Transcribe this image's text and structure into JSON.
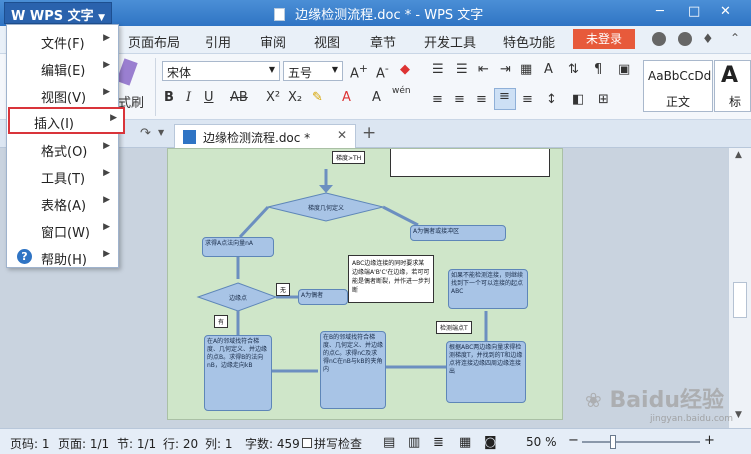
{
  "window": {
    "app_button": "WPS 文字",
    "title": "边缘检测流程.doc * - WPS 文字",
    "controls": [
      "─",
      "□",
      "✕"
    ]
  },
  "menubar": {
    "tabs": [
      "页面布局",
      "引用",
      "审阅",
      "视图",
      "章节",
      "开发工具",
      "特色功能"
    ],
    "login": "未登录"
  },
  "ribbon": {
    "font_name": "宋体",
    "font_size": "五号",
    "format_brush": "式刷",
    "style_sample": "AaBbCcDd",
    "style_name": "正文",
    "style_next": "标"
  },
  "tabs": {
    "document": "边缘检测流程.doc *"
  },
  "file_menu": {
    "items": [
      {
        "label": "文件(F)",
        "has_submenu": true
      },
      {
        "label": "编辑(E)",
        "has_submenu": true
      },
      {
        "label": "视图(V)",
        "has_submenu": true
      },
      {
        "label": "插入(I)",
        "has_submenu": true,
        "highlighted": true
      },
      {
        "label": "格式(O)",
        "has_submenu": true
      },
      {
        "label": "工具(T)",
        "has_submenu": true
      },
      {
        "label": "表格(A)",
        "has_submenu": true
      },
      {
        "label": "窗口(W)",
        "has_submenu": true
      },
      {
        "label": "帮助(H)",
        "has_submenu": true
      }
    ]
  },
  "flowchart": {
    "top_tag": "梯度>TH",
    "decision1": "梯度几何定义",
    "right_action": "A为偶者或接冲区",
    "box_a": "求得A点法向量nA",
    "note_abc": "ABC边缘连接的同时要求某边缘端A'B'C'在边缘，若可可能是偶者断裂，并作进一步判断",
    "tag_none": "无",
    "decision2": "边缘点",
    "tag_a_even": "A为偶者",
    "tag_have": "有",
    "box_b1": "在A的邻域找符合梯度、几何定义、并边缘的点B。求得B的法向nB，边缘走向kB",
    "box_b2": "在B的邻域找符合梯度、几何定义、并边缘的点C。求得nC及求得nC在nB与kB的夹角内",
    "tag_detect": "检测端点T",
    "box_c": "根据ABC两边缘向量求得检测梯度T，并找到的T和边缘点将连接边缘四周边缘连接出",
    "box_right": "如果不能检测连接，则继续找到下一个可以连接的起点ABC"
  },
  "status": {
    "page_code": "页码: 1",
    "page": "页面: 1/1",
    "section": "节: 1/1",
    "row": "行: 20",
    "col": "列: 1",
    "words": "字数: 459",
    "spell": "拼写检查",
    "zoom": "50 %"
  },
  "watermark": {
    "brand": "Baidu经验",
    "url": "jingyan.baidu.com"
  }
}
